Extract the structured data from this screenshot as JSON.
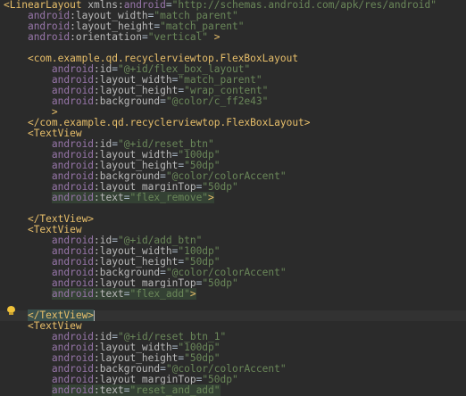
{
  "editor": {
    "lines": [
      {
        "segs": [
          [
            "tag",
            "<LinearLayout "
          ],
          [
            "attr",
            "xmlns:"
          ],
          [
            "attr-ns",
            "android"
          ],
          [
            "eq",
            "="
          ],
          [
            "val",
            "\"http://schemas.android.com/apk/res/android\""
          ]
        ]
      },
      {
        "segs": [
          [
            "plain",
            "    "
          ],
          [
            "attr-ns",
            "android"
          ],
          [
            "attr",
            ":layout_width"
          ],
          [
            "eq",
            "="
          ],
          [
            "val",
            "\"match_parent\""
          ]
        ]
      },
      {
        "segs": [
          [
            "plain",
            "    "
          ],
          [
            "attr-ns",
            "android"
          ],
          [
            "attr",
            ":layout_height"
          ],
          [
            "eq",
            "="
          ],
          [
            "val",
            "\"match_parent\""
          ]
        ]
      },
      {
        "segs": [
          [
            "plain",
            "    "
          ],
          [
            "attr-ns",
            "android"
          ],
          [
            "attr",
            ":orientation"
          ],
          [
            "eq",
            "="
          ],
          [
            "val",
            "\"vertical\""
          ],
          [
            "tag",
            " >"
          ]
        ]
      },
      {
        "segs": []
      },
      {
        "segs": [
          [
            "plain",
            "    "
          ],
          [
            "tag",
            "<com.example.qd.recyclerviewtop.FlexBoxLayout"
          ]
        ]
      },
      {
        "segs": [
          [
            "plain",
            "        "
          ],
          [
            "attr-ns",
            "android"
          ],
          [
            "attr",
            ":id"
          ],
          [
            "eq",
            "="
          ],
          [
            "val",
            "\"@+id/flex_box_layout\""
          ]
        ]
      },
      {
        "segs": [
          [
            "plain",
            "        "
          ],
          [
            "attr-ns",
            "android"
          ],
          [
            "attr",
            ":layout_width"
          ],
          [
            "eq",
            "="
          ],
          [
            "val",
            "\"match_parent\""
          ]
        ]
      },
      {
        "segs": [
          [
            "plain",
            "        "
          ],
          [
            "attr-ns",
            "android"
          ],
          [
            "attr",
            ":layout_height"
          ],
          [
            "eq",
            "="
          ],
          [
            "val",
            "\"wrap_content\""
          ]
        ]
      },
      {
        "segs": [
          [
            "plain",
            "        "
          ],
          [
            "attr-ns",
            "android"
          ],
          [
            "attr",
            ":background"
          ],
          [
            "eq",
            "="
          ],
          [
            "val",
            "\"@color/c_ff2e43\""
          ]
        ]
      },
      {
        "segs": [
          [
            "plain",
            "        "
          ],
          [
            "tag",
            ">"
          ]
        ]
      },
      {
        "segs": [
          [
            "plain",
            "    "
          ],
          [
            "tag",
            "</com.example.qd.recyclerviewtop.FlexBoxLayout>"
          ]
        ]
      },
      {
        "segs": [
          [
            "plain",
            "    "
          ],
          [
            "tag",
            "<TextView"
          ]
        ]
      },
      {
        "segs": [
          [
            "plain",
            "        "
          ],
          [
            "attr-ns",
            "android"
          ],
          [
            "attr",
            ":id"
          ],
          [
            "eq",
            "="
          ],
          [
            "val",
            "\"@+id/reset_btn\""
          ]
        ]
      },
      {
        "segs": [
          [
            "plain",
            "        "
          ],
          [
            "attr-ns",
            "android"
          ],
          [
            "attr",
            ":layout_width"
          ],
          [
            "eq",
            "="
          ],
          [
            "val",
            "\"100dp\""
          ]
        ]
      },
      {
        "segs": [
          [
            "plain",
            "        "
          ],
          [
            "attr-ns",
            "android"
          ],
          [
            "attr",
            ":layout_height"
          ],
          [
            "eq",
            "="
          ],
          [
            "val",
            "\"50dp\""
          ]
        ]
      },
      {
        "segs": [
          [
            "plain",
            "        "
          ],
          [
            "attr-ns",
            "android"
          ],
          [
            "attr",
            ":background"
          ],
          [
            "eq",
            "="
          ],
          [
            "val",
            "\"@color/colorAccent\""
          ]
        ]
      },
      {
        "segs": [
          [
            "plain",
            "        "
          ],
          [
            "attr-ns",
            "android"
          ],
          [
            "attr",
            ":layout_marginTop"
          ],
          [
            "eq",
            "="
          ],
          [
            "val",
            "\"50dp\""
          ]
        ]
      },
      {
        "hl": "hl",
        "segs": [
          [
            "plain",
            "        "
          ],
          [
            "attr-ns",
            "android"
          ],
          [
            "attr",
            ":text"
          ],
          [
            "eq",
            "="
          ],
          [
            "val",
            "\"flex_remove\""
          ],
          [
            "tag",
            ">"
          ]
        ]
      },
      {
        "segs": []
      },
      {
        "segs": [
          [
            "plain",
            "    "
          ],
          [
            "tag",
            "</TextView>"
          ]
        ]
      },
      {
        "segs": [
          [
            "plain",
            "    "
          ],
          [
            "tag",
            "<TextView"
          ]
        ]
      },
      {
        "segs": [
          [
            "plain",
            "        "
          ],
          [
            "attr-ns",
            "android"
          ],
          [
            "attr",
            ":id"
          ],
          [
            "eq",
            "="
          ],
          [
            "val",
            "\"@+id/add_btn\""
          ]
        ]
      },
      {
        "segs": [
          [
            "plain",
            "        "
          ],
          [
            "attr-ns",
            "android"
          ],
          [
            "attr",
            ":layout_width"
          ],
          [
            "eq",
            "="
          ],
          [
            "val",
            "\"100dp\""
          ]
        ]
      },
      {
        "segs": [
          [
            "plain",
            "        "
          ],
          [
            "attr-ns",
            "android"
          ],
          [
            "attr",
            ":layout_height"
          ],
          [
            "eq",
            "="
          ],
          [
            "val",
            "\"50dp\""
          ]
        ]
      },
      {
        "segs": [
          [
            "plain",
            "        "
          ],
          [
            "attr-ns",
            "android"
          ],
          [
            "attr",
            ":background"
          ],
          [
            "eq",
            "="
          ],
          [
            "val",
            "\"@color/colorAccent\""
          ]
        ]
      },
      {
        "segs": [
          [
            "plain",
            "        "
          ],
          [
            "attr-ns",
            "android"
          ],
          [
            "attr",
            ":layout_marginTop"
          ],
          [
            "eq",
            "="
          ],
          [
            "val",
            "\"50dp\""
          ]
        ]
      },
      {
        "hl": "hl",
        "segs": [
          [
            "plain",
            "        "
          ],
          [
            "attr-ns",
            "android"
          ],
          [
            "attr",
            ":text"
          ],
          [
            "eq",
            "="
          ],
          [
            "val",
            "\"flex_add\""
          ],
          [
            "tag",
            ">"
          ]
        ]
      },
      {
        "segs": []
      },
      {
        "current": true,
        "segs": [
          [
            "plain",
            "    "
          ],
          [
            "cursor-tag",
            "</TextView>"
          ]
        ]
      },
      {
        "segs": [
          [
            "plain",
            "    "
          ],
          [
            "tag",
            "<TextView"
          ]
        ]
      },
      {
        "segs": [
          [
            "plain",
            "        "
          ],
          [
            "attr-ns",
            "android"
          ],
          [
            "attr",
            ":id"
          ],
          [
            "eq",
            "="
          ],
          [
            "val",
            "\"@+id/reset_btn_1\""
          ]
        ]
      },
      {
        "segs": [
          [
            "plain",
            "        "
          ],
          [
            "attr-ns",
            "android"
          ],
          [
            "attr",
            ":layout_width"
          ],
          [
            "eq",
            "="
          ],
          [
            "val",
            "\"100dp\""
          ]
        ]
      },
      {
        "segs": [
          [
            "plain",
            "        "
          ],
          [
            "attr-ns",
            "android"
          ],
          [
            "attr",
            ":layout_height"
          ],
          [
            "eq",
            "="
          ],
          [
            "val",
            "\"50dp\""
          ]
        ]
      },
      {
        "segs": [
          [
            "plain",
            "        "
          ],
          [
            "attr-ns",
            "android"
          ],
          [
            "attr",
            ":background"
          ],
          [
            "eq",
            "="
          ],
          [
            "val",
            "\"@color/colorAccent\""
          ]
        ]
      },
      {
        "segs": [
          [
            "plain",
            "        "
          ],
          [
            "attr-ns",
            "android"
          ],
          [
            "attr",
            ":layout_marginTop"
          ],
          [
            "eq",
            "="
          ],
          [
            "val",
            "\"50dp\""
          ]
        ]
      },
      {
        "hl": "hl",
        "segs": [
          [
            "plain",
            "        "
          ],
          [
            "attr-ns",
            "android"
          ],
          [
            "attr",
            ":text"
          ],
          [
            "eq",
            "="
          ],
          [
            "val",
            "\"reset_and_add\""
          ]
        ]
      }
    ],
    "gutter_icon": "lightbulb-icon"
  }
}
